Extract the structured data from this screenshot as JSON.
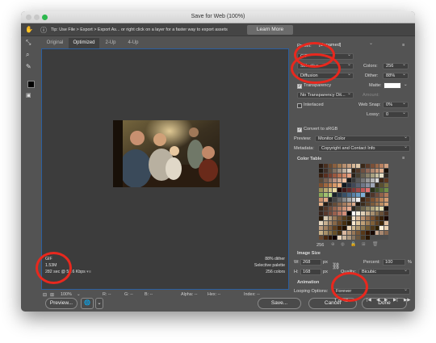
{
  "window": {
    "title": "Save for Web (100%)"
  },
  "tipbar": {
    "tip": "Tip: Use File > Export > Export As... or right click on a layer for a faster way to export assets",
    "learn_more": "Learn More"
  },
  "tabs": [
    "Original",
    "Optimized",
    "2-Up",
    "4-Up"
  ],
  "preview_info": {
    "format": "GIF",
    "size": "1.53M",
    "time": "282 sec @ 56.6 Kbps",
    "dither": "88% dither",
    "palette": "Selective palette",
    "colors": "256 colors"
  },
  "status": {
    "zoom": "100%",
    "r": "R: --",
    "g": "G: --",
    "b": "B: --",
    "alpha": "Alpha: --",
    "hex": "Hex: --",
    "index": "Index: --"
  },
  "buttons": {
    "preview": "Preview...",
    "save": "Save...",
    "cancel": "Cancel",
    "done": "Done"
  },
  "settings": {
    "preset_label": "Preset:",
    "preset_value": "[Unnamed]",
    "format": "GIF",
    "reduction": "Selective",
    "colors_label": "Colors:",
    "colors_value": "256",
    "dither_algo": "Diffusion",
    "dither_label": "Dither:",
    "dither_value": "88%",
    "transparency": "Transparency",
    "matte_label": "Matte:",
    "trans_dither": "No Transparency Dit...",
    "amount_label": "Amount:",
    "interlaced": "Interlaced",
    "websnap_label": "Web Snap:",
    "websnap_value": "0%",
    "lossy_label": "Lossy:",
    "lossy_value": "0",
    "convert_srgb": "Convert to sRGB",
    "preview_label": "Preview:",
    "preview_value": "Monitor Color",
    "metadata_label": "Metadata:",
    "metadata_value": "Copyright and Contact Info",
    "color_table_label": "Color Table",
    "color_count": "256"
  },
  "image_size": {
    "label": "Image Size",
    "w_label": "W:",
    "w_value": "268",
    "h_label": "H:",
    "h_value": "168",
    "unit": "px",
    "percent_label": "Percent:",
    "percent_value": "100",
    "percent_unit": "%",
    "quality_label": "Quality:",
    "quality_value": "Bicubic"
  },
  "animation": {
    "label": "Animation",
    "looping_label": "Looping Options:",
    "looping_value": "Forever",
    "frame": "1 of 42"
  },
  "palette_colors": [
    "#2a1a10",
    "#4a3020",
    "#6b4a30",
    "#8a6040",
    "#a07850",
    "#b89070",
    "#c8a080",
    "#d8b898",
    "#e0c8a8",
    "#3a2818",
    "#5a3a28",
    "#7a5038",
    "#9a6848",
    "#b88060",
    "#d0a080",
    "#201810",
    "#403028",
    "#605040",
    "#807060",
    "#a09080",
    "#c0b0a0",
    "#e0d0c0",
    "#302010",
    "#503828",
    "#705040",
    "#906858",
    "#b08870",
    "#c89878",
    "#e0b090",
    "#1a1008",
    "#3a2010",
    "#5a3020",
    "#7a4030",
    "#9a5840",
    "#b87050",
    "#d08868",
    "#e8a080",
    "#282018",
    "#484030",
    "#686050",
    "#888068",
    "#a8a080",
    "#c8c0a0",
    "#e8e0c8",
    "#302820",
    "#584838",
    "#786050",
    "#987868",
    "#b89080",
    "#d0a890",
    "#f0c0a0",
    "#181818",
    "#383838",
    "#585858",
    "#787878",
    "#989898",
    "#b8b8b8",
    "#d8d8d8",
    "#402818",
    "#603820",
    "#805030",
    "#a06840",
    "#c08050",
    "#d89868",
    "#f0b080",
    "#101820",
    "#283040",
    "#404858",
    "#586070",
    "#707888",
    "#8890a0",
    "#a0a8b8",
    "#3a3020",
    "#5a5030",
    "#7a7040",
    "#9a9058",
    "#b8a870",
    "#d0c088",
    "#e8d8a0",
    "#200808",
    "#401818",
    "#602828",
    "#803838",
    "#a04848",
    "#c05858",
    "#e07070",
    "#283018",
    "#405028",
    "#587038",
    "#709048",
    "#88a858",
    "#a0c070",
    "#b8d888",
    "#182028",
    "#283848",
    "#385068",
    "#486888",
    "#5880a8",
    "#6898c0",
    "#80b0d8",
    "#30201a",
    "#50362a",
    "#704c3a",
    "#90624a",
    "#b07a5a",
    "#c8906c",
    "#e0a884",
    "#222222",
    "#444444",
    "#666666",
    "#888888",
    "#aaaaaa",
    "#cccccc",
    "#eeeeee",
    "#3c2414",
    "#5c3a22",
    "#7c5232",
    "#9c6a44",
    "#ba8458",
    "#d29c70",
    "#eab48a",
    "#261c14",
    "#463426",
    "#664c38",
    "#86644a",
    "#a67c5e",
    "#c29474",
    "#dcac8c",
    "#1c140c",
    "#3c2c1c",
    "#5c442c",
    "#7c5c3c",
    "#9c744e",
    "#ba8c62",
    "#d6a478",
    "#342418",
    "#54382a",
    "#744e3c",
    "#94644e",
    "#b27c62",
    "#cc9478",
    "#e6ac90",
    "#2e2a22",
    "#4e4838",
    "#6e664e",
    "#8e8464",
    "#aea27c",
    "#cac094",
    "#e4dcb0",
    "#18100c",
    "#38241c",
    "#58382c",
    "#784c3c",
    "#98604e",
    "#b67662",
    "#d28e78",
    "#000000",
    "#ffffff",
    "#f8f0e0",
    "#e0d0b8",
    "#c8b090",
    "#a89070",
    "#887050",
    "#685038",
    "#483020",
    "#281808",
    "#d8c8b0",
    "#b8a080",
    "#987858",
    "#785838",
    "#584020",
    "#382810",
    "#f0e0c8",
    "#d8b898",
    "#b89070",
    "#987050",
    "#785030",
    "#583818",
    "#382008",
    "#180800",
    "#e8d8c0",
    "#c8b090",
    "#a88868",
    "#886848",
    "#684828",
    "#483010",
    "#281800",
    "#f8e8d0",
    "#e0c8a0",
    "#c0a078",
    "#a08058",
    "#806038",
    "#604020",
    "#402808",
    "#e0c0a0",
    "#c0a080",
    "#a08060",
    "#806040",
    "#604020",
    "#402000",
    "#201000",
    "#f0d8b8",
    "#d0b890",
    "#b09870",
    "#907850",
    "#705830",
    "#503818",
    "#302000",
    "#fff0d8",
    "#e8d0b0",
    "#c8b088",
    "#a89068",
    "#887048",
    "#685028",
    "#483010",
    "#d8b8a0",
    "#b89878",
    "#987858",
    "#785838",
    "#583818",
    "#381800",
    "#180800",
    "#c8a890",
    "#a88870",
    "#886850",
    "#684830",
    "#482810",
    "#281000",
    "#100000",
    "#ead6be",
    "#cab69e",
    "#aa967e",
    "#8a765e",
    "#6a563e",
    "#4a361e",
    "#2a1600"
  ]
}
